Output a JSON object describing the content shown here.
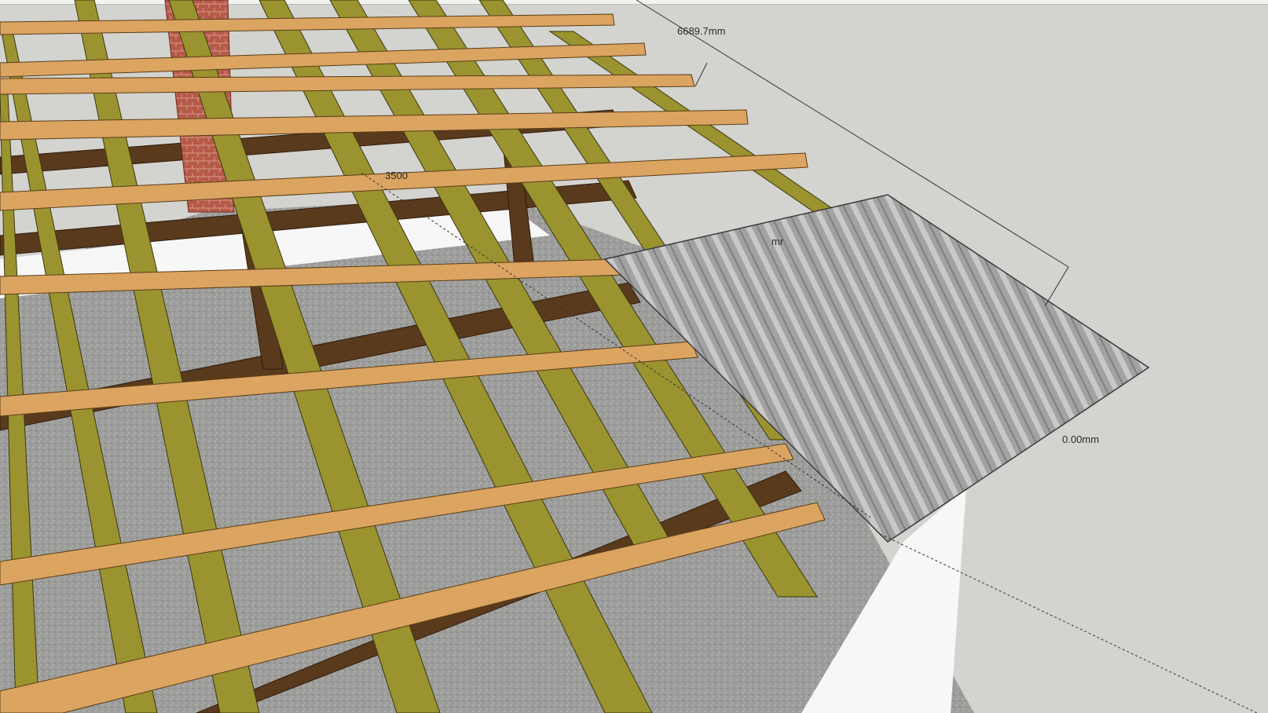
{
  "viewport": {
    "background": "#d3d3cf",
    "sky_color": "#d3d3cf",
    "ground_color": "#9a9a98"
  },
  "dimensions": {
    "top_length": "6689.7mm",
    "middle_length": "3500",
    "partial_label": "mr",
    "zero_offset": "0.00mm"
  },
  "materials": {
    "rafter_color": "#8f8a2c",
    "rafter_highlight": "#b5ad3c",
    "batten_color": "#d9a35c",
    "batten_highlight": "#e9bc7a",
    "beam_color": "#5a3a1c",
    "chimney_color": "#b65a48",
    "roof_sheet_color": "#a6a6a6",
    "roof_sheet_ridge": "#d6d6d6",
    "wall_color": "#f8f8f8",
    "floor_color": "#9a9a98"
  }
}
